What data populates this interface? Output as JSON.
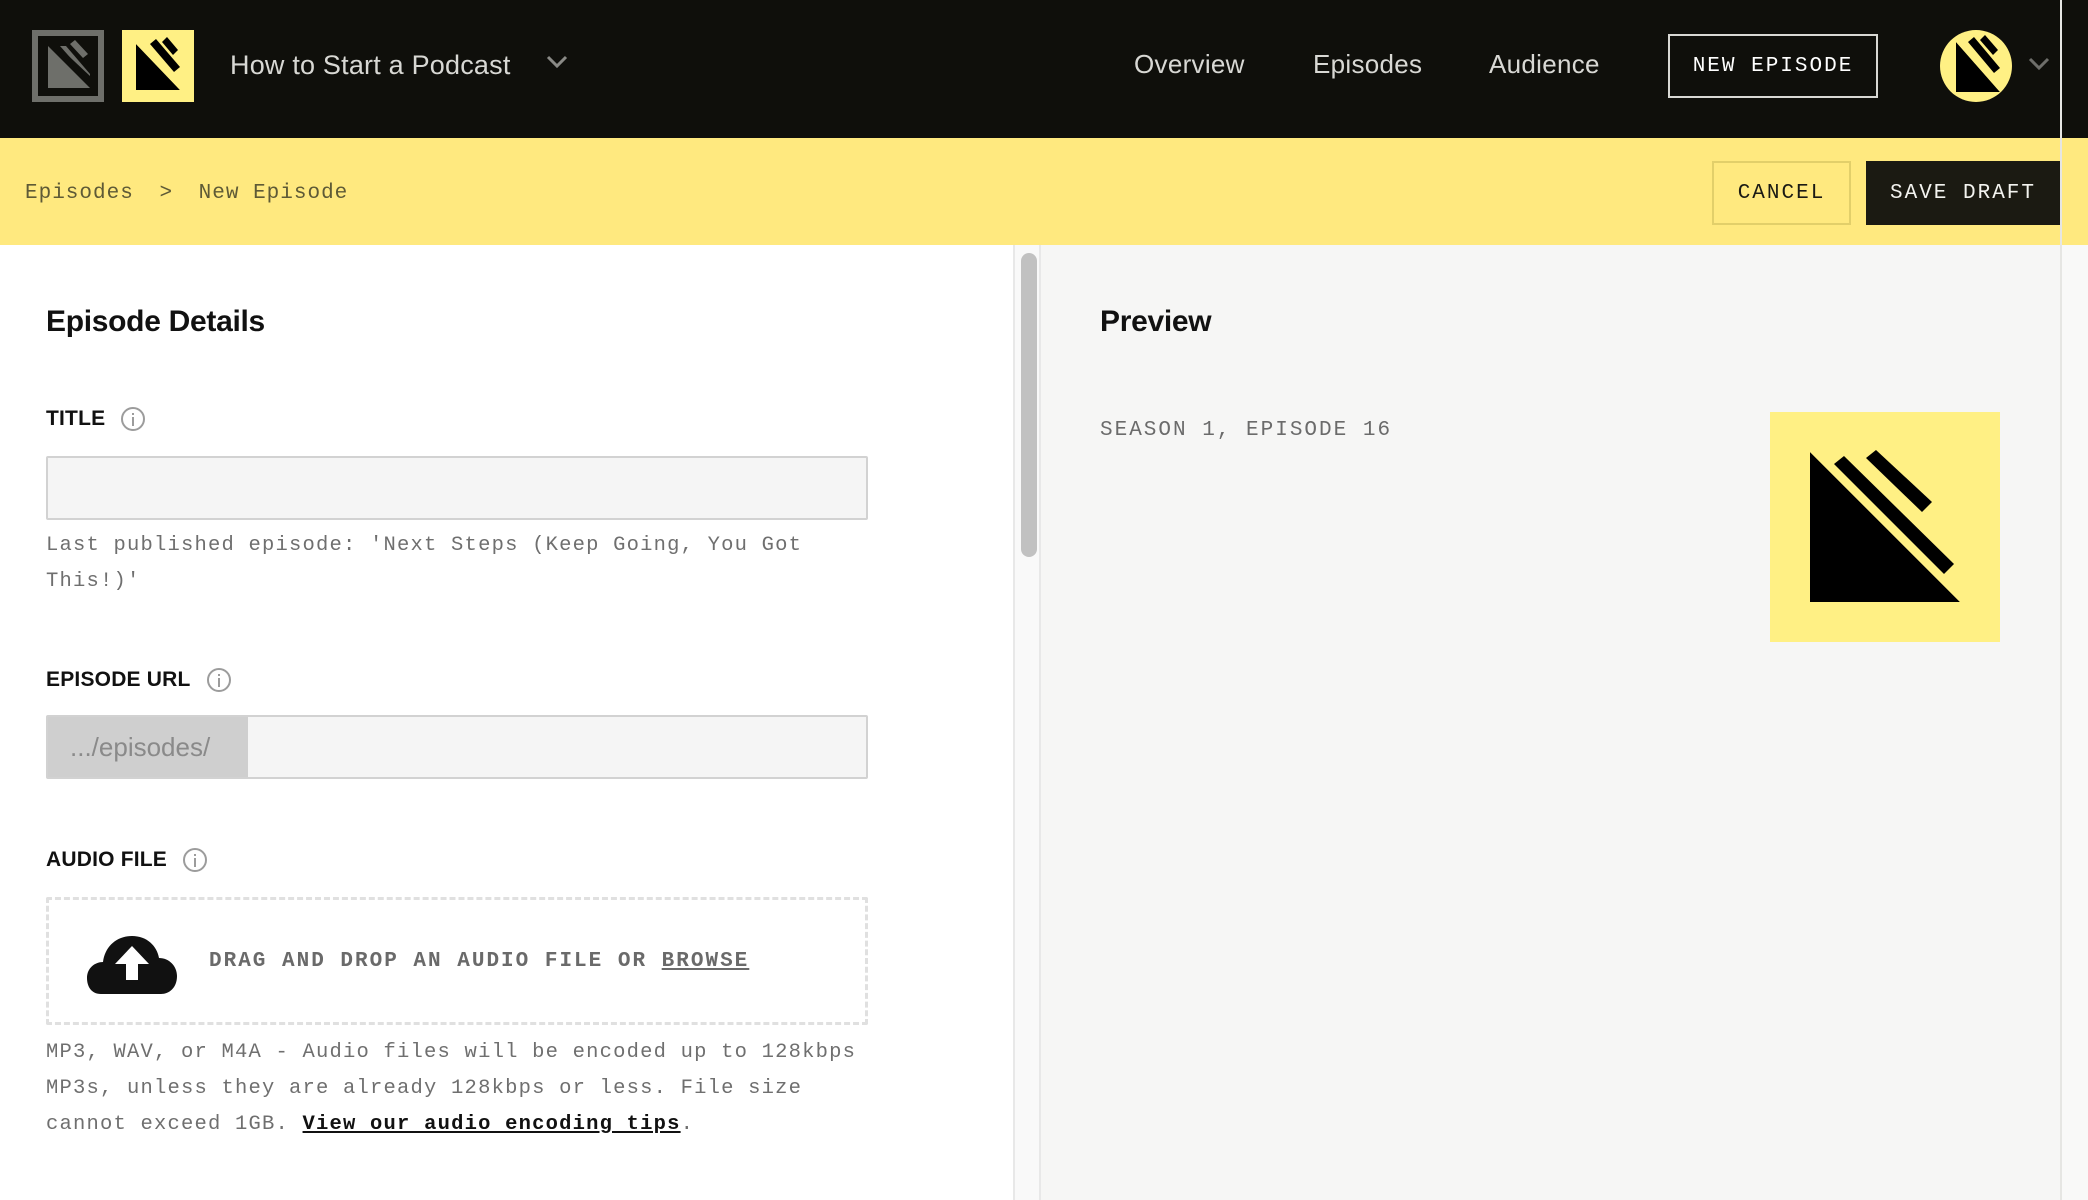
{
  "header": {
    "podcast_name": "How to Start a Podcast",
    "nav": [
      {
        "label": "Overview"
      },
      {
        "label": "Episodes"
      },
      {
        "label": "Audience"
      }
    ],
    "new_episode_button": "NEW EPISODE"
  },
  "actionbar": {
    "breadcrumb": [
      {
        "label": "Episodes"
      },
      {
        "separator": ">"
      },
      {
        "label": "New Episode"
      }
    ],
    "cancel_label": "CANCEL",
    "save_label": "SAVE DRAFT"
  },
  "form": {
    "section_title": "Episode Details",
    "title_field": {
      "label": "TITLE",
      "value": "",
      "placeholder": "",
      "helper": "Last published episode: 'Next Steps (Keep Going, You Got This!)'"
    },
    "url_field": {
      "label": "EPISODE URL",
      "prefix": ".../episodes/",
      "value": "",
      "placeholder": ""
    },
    "audio_field": {
      "label": "AUDIO FILE",
      "dropzone_text": "DRAG AND DROP AN AUDIO FILE OR ",
      "browse_label": "BROWSE",
      "helper": "MP3, WAV, or M4A - Audio files will be encoded up to 128kbps MP3s, unless they are already 128kbps or less. File size cannot exceed 1GB. ",
      "tips_link": "View our audio encoding tips",
      "helper_end": "."
    }
  },
  "preview": {
    "title": "Preview",
    "season_episode": "SEASON 1, EPISODE 16"
  },
  "colors": {
    "header_bg": "#0f0f0b",
    "brand_yellow": "#fff084",
    "actionbar_yellow": "#ffe97f",
    "save_button_bg": "#1b1a12"
  },
  "icons": {
    "app_logo": "podcast-logo-mono",
    "podcast_logo": "podcast-logo-brand",
    "info": "info-circle-icon",
    "upload": "cloud-upload-icon",
    "chevron": "chevron-down-icon"
  }
}
